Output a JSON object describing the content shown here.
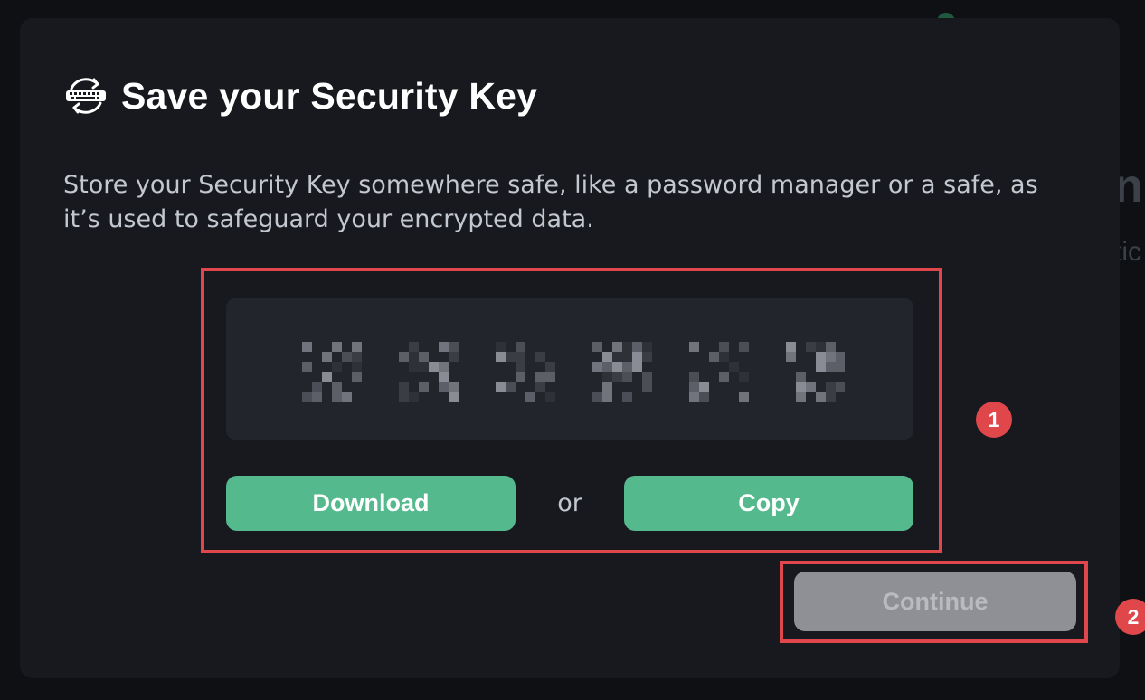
{
  "dialog": {
    "title": "Save your Security Key",
    "title_icon": "security-key-sync-icon",
    "description": "Store your Security Key somewhere safe, like a password manager or a safe, as it’s used to safeguard your encrypted data.",
    "key_state": "blurred",
    "download_label": "Download",
    "separator": "or",
    "copy_label": "Copy",
    "continue_label": "Continue",
    "continue_disabled": true
  },
  "annotations": {
    "badge_1": "1",
    "badge_2": "2"
  },
  "colors": {
    "dialog_bg": "#17191e",
    "accent_green": "#54b98c",
    "annotation_red": "#e0474c",
    "disabled_gray": "#8e9096"
  }
}
